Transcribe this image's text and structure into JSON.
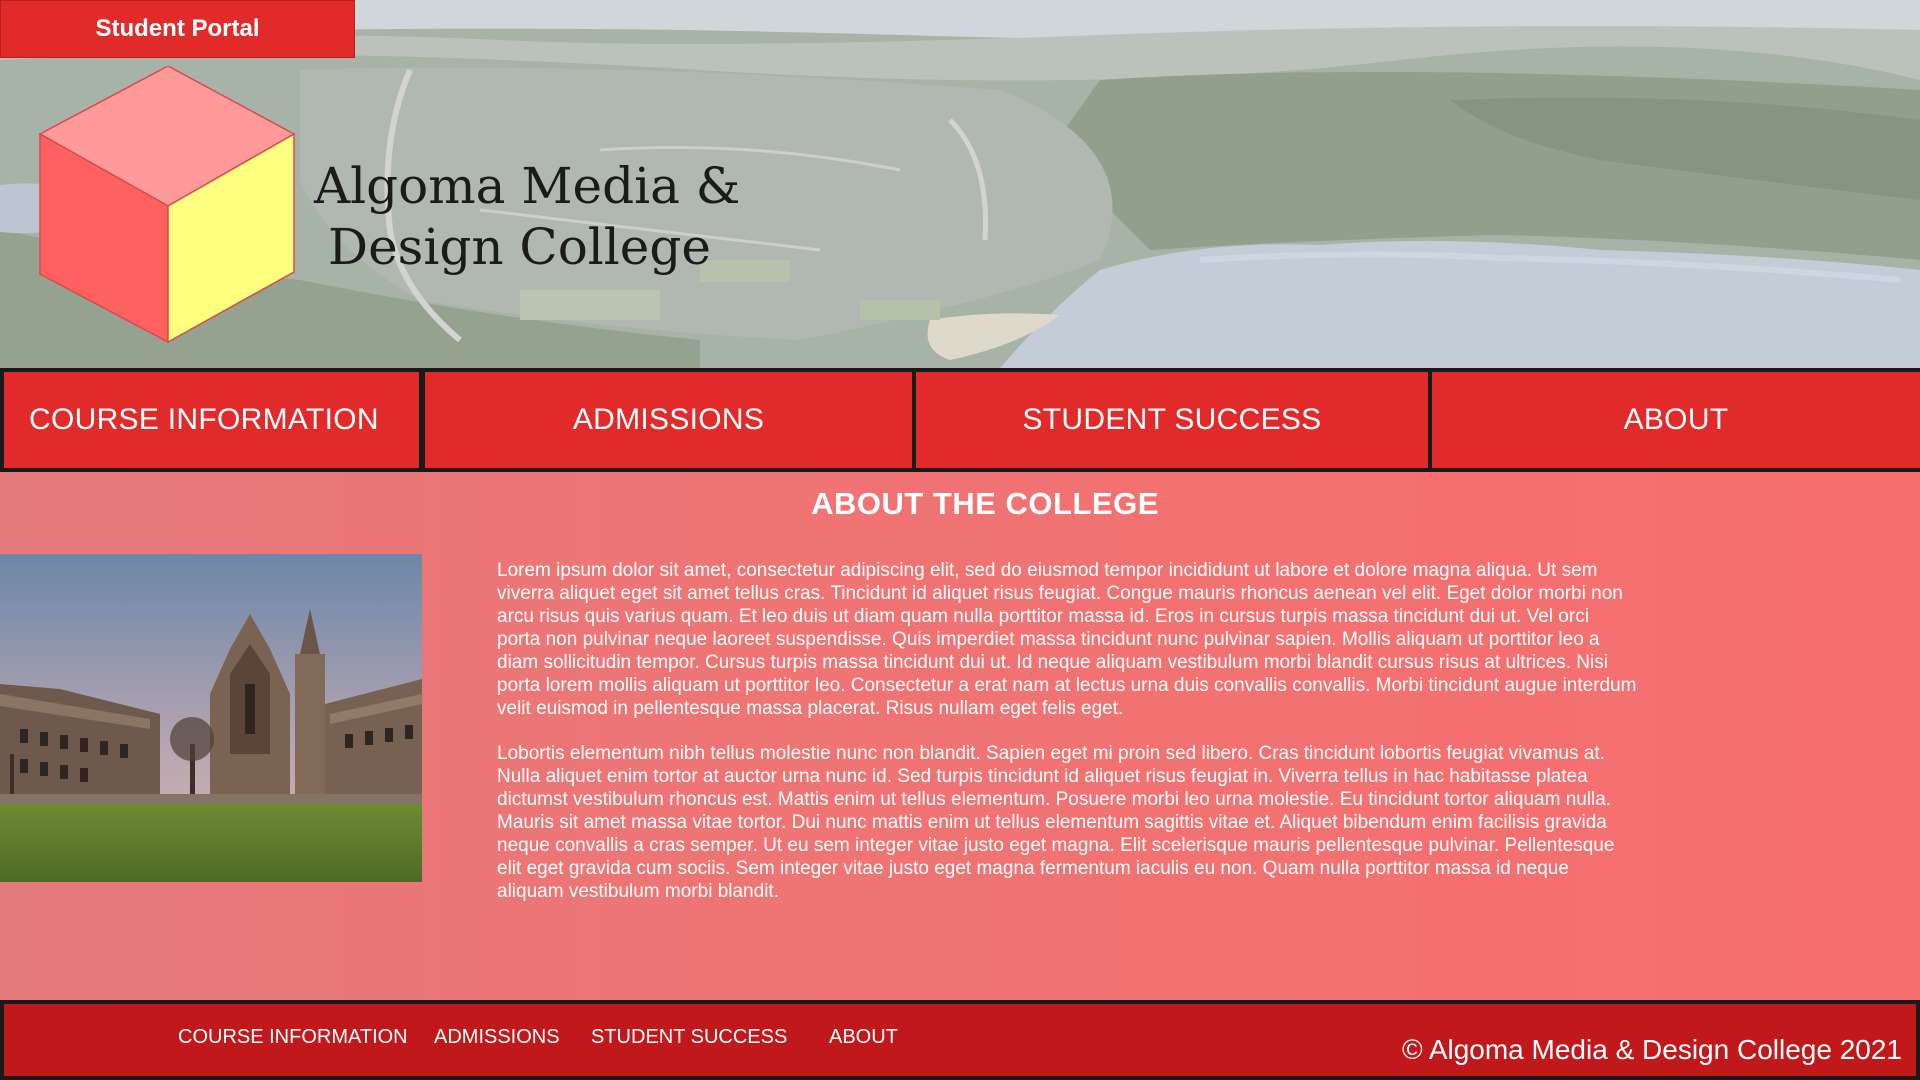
{
  "header": {
    "portal_button": "Student Portal",
    "logo_line1": "Algoma Media &",
    "logo_line2": "Design College"
  },
  "nav": {
    "items": [
      {
        "label": "COURSE INFORMATION"
      },
      {
        "label": "ADMISSIONS"
      },
      {
        "label": "STUDENT SUCCESS"
      },
      {
        "label": "ABOUT"
      }
    ]
  },
  "main": {
    "title": "ABOUT THE COLLEGE",
    "paragraphs": [
      "Lorem ipsum dolor sit amet, consectetur adipiscing elit, sed do eiusmod tempor incididunt ut labore et dolore magna aliqua. Ut sem viverra aliquet eget sit amet tellus cras. Tincidunt id aliquet risus feugiat. Congue mauris rhoncus aenean vel elit. Eget dolor morbi non arcu risus quis varius quam. Et leo duis ut diam quam nulla porttitor massa id. Eros in cursus turpis massa tincidunt dui ut. Vel orci porta non pulvinar neque laoreet suspendisse. Quis imperdiet massa tincidunt nunc pulvinar sapien. Mollis aliquam ut porttitor leo a diam sollicitudin tempor. Cursus turpis massa tincidunt dui ut. Id neque aliquam vestibulum morbi blandit cursus risus at ultrices. Nisi porta lorem mollis aliquam ut porttitor leo. Consectetur a erat nam at lectus urna duis convallis convallis. Morbi tincidunt augue interdum velit euismod in pellentesque massa placerat. Risus nullam eget felis eget.",
      "Lobortis elementum nibh tellus molestie nunc non blandit. Sapien eget mi proin sed libero. Cras tincidunt lobortis feugiat vivamus at. Nulla aliquet enim tortor at auctor urna nunc id. Sed turpis tincidunt id aliquet risus feugiat in. Viverra tellus in hac habitasse platea dictumst vestibulum rhoncus est. Mattis enim ut tellus elementum. Posuere morbi leo urna molestie. Eu tincidunt tortor aliquam nulla. Mauris sit amet massa vitae tortor. Dui nunc mattis enim ut tellus elementum sagittis vitae et. Aliquet bibendum enim facilisis gravida neque convallis a cras semper. Ut eu sem integer vitae justo eget magna. Elit scelerisque mauris pellentesque pulvinar. Pellentesque elit eget gravida cum sociis. Sem integer vitae justo eget magna fermentum iaculis eu non. Quam nulla porttitor massa id neque aliquam vestibulum morbi blandit."
    ]
  },
  "footer": {
    "links": [
      {
        "label": "COURSE INFORMATION"
      },
      {
        "label": "ADMISSIONS"
      },
      {
        "label": "STUDENT SUCCESS"
      },
      {
        "label": "ABOUT"
      }
    ],
    "copyright": "© Algoma Media & Design College 2021"
  },
  "colors": {
    "brand_red": "#e12b2b",
    "footer_red": "#c0181b",
    "content_bg": "#f47070",
    "cube_top": "#ff9a9a",
    "cube_left": "#ff6060",
    "cube_right": "#ffff80"
  }
}
